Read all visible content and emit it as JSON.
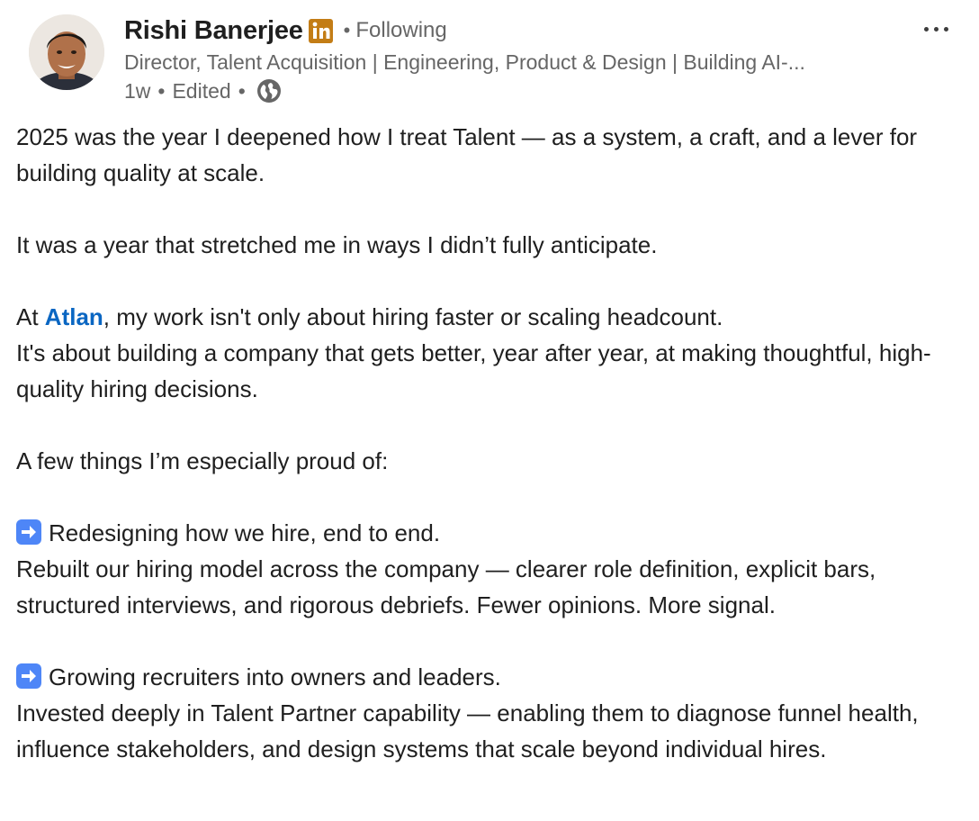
{
  "post": {
    "author": {
      "name": "Rishi Banerjee",
      "follow_status": "Following",
      "headline": "Director, Talent Acquisition | Engineering, Product & Design | Building AI-...",
      "time_ago": "1w",
      "edited_label": "Edited"
    },
    "icons": {
      "premium_badge": "linkedin-premium-badge-icon",
      "visibility": "globe-icon",
      "more": "more-options-icon",
      "bullet": "right-arrow-emoji"
    },
    "colors": {
      "mention": "#0a66c2",
      "premium_badge": "#c37d16",
      "arrow_emoji": "#4e86f7"
    },
    "body": {
      "p1": "2025 was the year I deepened how I treat Talent — as a system, a craft, and a lever for building quality at scale.",
      "p2": "It was a year that stretched me in ways I didn’t fully anticipate.",
      "p3_prefix": "At ",
      "p3_mention": "Atlan",
      "p3_suffix": ", my work isn't only about hiring faster or scaling headcount.",
      "p3_line2": "It's about building a company that gets better, year after year, at making thoughtful, high-quality hiring decisions.",
      "p4": "A few things I’m especially proud of:",
      "item1_title": "Redesigning how we hire, end to end.",
      "item1_body": "Rebuilt our hiring model across the company — clearer role definition, explicit bars, structured interviews, and rigorous debriefs. Fewer opinions. More signal.",
      "item2_title": "Growing recruiters into owners and leaders.",
      "item2_body": "Invested deeply in Talent Partner capability — enabling them to diagnose funnel health, influence stakeholders, and design systems that scale beyond individual hires."
    }
  }
}
